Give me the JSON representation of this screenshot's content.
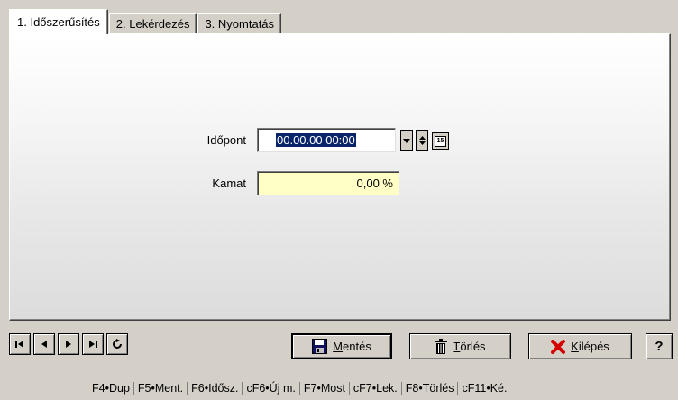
{
  "tabs": [
    {
      "label": "1. Időszerűsítés",
      "active": true
    },
    {
      "label": "2. Lekérdezés",
      "active": false
    },
    {
      "label": "3. Nyomtatás",
      "active": false
    }
  ],
  "form": {
    "idopont_label": "Időpont",
    "idopont_value": "00.00.00 00:00",
    "calendar_glyph": "15",
    "kamat_label": "Kamat",
    "kamat_value": "0,00 %",
    "field_bg_color": "#ffffc6",
    "selection_color": "#0a246a"
  },
  "buttons": {
    "save_label": "Mentés",
    "save_accel": "M",
    "save_rest": "entés",
    "delete_accel": "T",
    "delete_rest": "örlés",
    "exit_accel": "K",
    "exit_rest": "ilépés",
    "help_label": "?"
  },
  "statusbar": [
    "F4•Dup",
    "F5•Ment.",
    "F6•Idősz.",
    "cF6•Új m.",
    "F7•Most",
    "cF7•Lek.",
    "F8•Törlés",
    "cF11•Ké."
  ],
  "icons": {
    "first": "first-record-icon",
    "prev": "previous-record-icon",
    "next": "next-record-icon",
    "last": "last-record-icon",
    "refresh": "refresh-icon",
    "save": "floppy-disk-icon",
    "delete": "trash-can-icon",
    "exit": "red-x-icon",
    "exit_color": "#d40000"
  }
}
